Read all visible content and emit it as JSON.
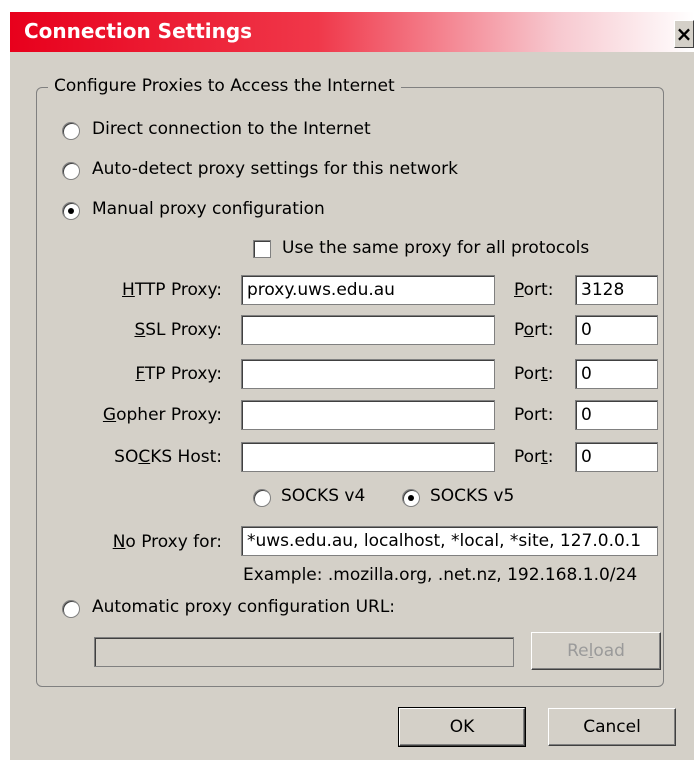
{
  "window": {
    "title": "Connection Settings",
    "close_glyph": "×"
  },
  "group": {
    "legend": "Configure Proxies to Access the Internet"
  },
  "options": {
    "direct": "Direct connection to the Internet",
    "autodetect": "Auto-detect proxy settings for this network",
    "manual": "Manual proxy configuration",
    "auto_url": "Automatic proxy configuration URL:"
  },
  "same_proxy": {
    "label": "Use the same proxy for all protocols",
    "checked": false
  },
  "proxies": {
    "http": {
      "l1": "",
      "u": "H",
      "l2": "TTP Proxy:",
      "host": "proxy.uws.edu.au",
      "port_a": "",
      "port_u": "P",
      "port_b": "ort:",
      "port": "3128"
    },
    "ssl": {
      "l1": "",
      "u": "S",
      "l2": "SL Proxy:",
      "host": "",
      "port_a": "P",
      "port_u": "o",
      "port_b": "rt:",
      "port": "0"
    },
    "ftp": {
      "l1": "",
      "u": "F",
      "l2": "TP Proxy:",
      "host": "",
      "port_a": "Por",
      "port_u": "t",
      "port_b": ":",
      "port": "0"
    },
    "gopher": {
      "l1": "",
      "u": "G",
      "l2": "opher Proxy:",
      "host": "",
      "port_a": "Port:",
      "port_u": "",
      "port_b": "",
      "port": "0"
    },
    "socks": {
      "l1": "SO",
      "u": "C",
      "l2": "KS Host:",
      "host": "",
      "port_a": "Por",
      "port_u": "t",
      "port_b": ":",
      "port": "0"
    }
  },
  "socks_version": {
    "v4": "SOCKS v4",
    "v5": "SOCKS v5",
    "selected": "v5"
  },
  "no_proxy": {
    "u": "N",
    "rest": "o Proxy for:",
    "value": "*uws.edu.au, localhost, *local, *site, 127.0.0.1"
  },
  "example": "Example: .mozilla.org, .net.nz, 192.168.1.0/24",
  "auto_url_value": "",
  "reload": {
    "a": "Re",
    "u": "l",
    "b": "oad"
  },
  "buttons": {
    "ok": "OK",
    "cancel": "Cancel"
  }
}
